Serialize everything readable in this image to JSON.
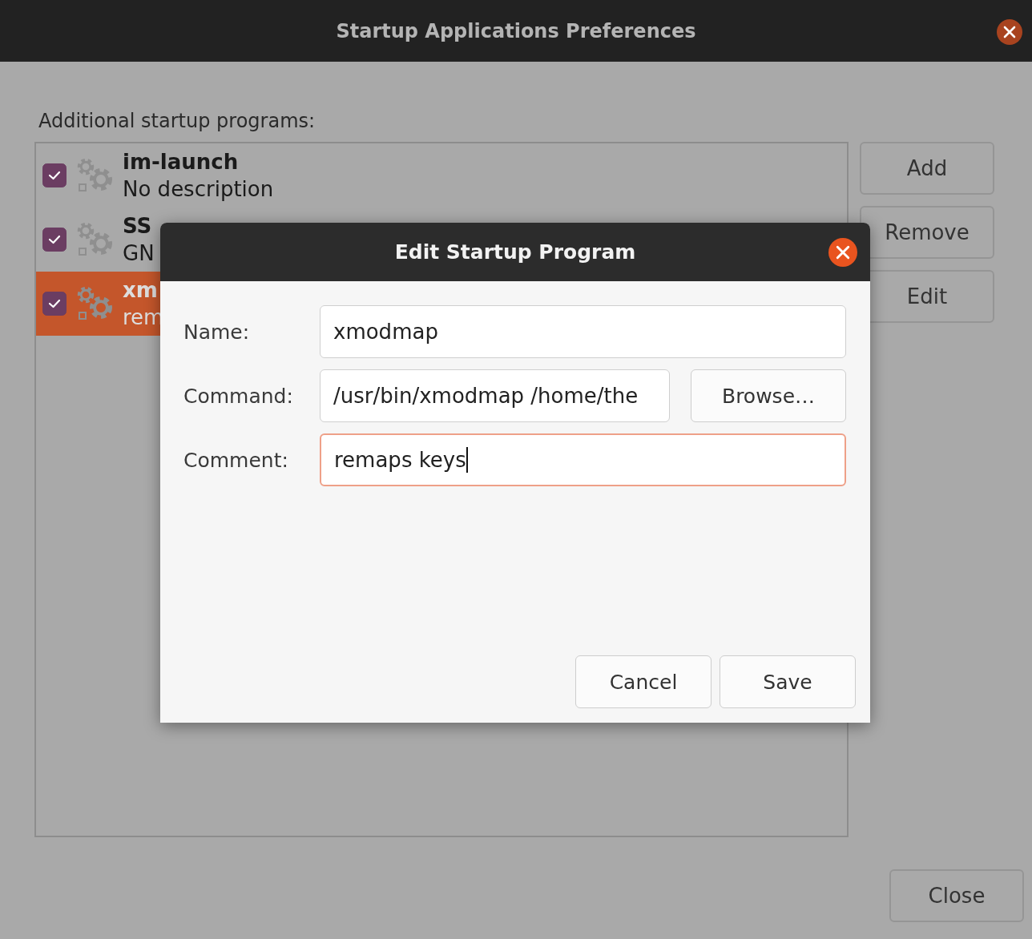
{
  "window": {
    "title": "Startup Applications Preferences"
  },
  "list_label": "Additional startup programs:",
  "programs": [
    {
      "name": "im-launch",
      "description": "No description",
      "enabled": true,
      "selected": false
    },
    {
      "name": "SS",
      "description": "GN",
      "enabled": true,
      "selected": false
    },
    {
      "name": "xm",
      "description": "rem",
      "enabled": true,
      "selected": true
    }
  ],
  "side_buttons": [
    "Add",
    "Remove",
    "Edit"
  ],
  "close_button": "Close",
  "dialog": {
    "title": "Edit Startup Program",
    "fields": [
      {
        "label": "Name:",
        "value": "xmodmap",
        "focused": false
      },
      {
        "label": "Command:",
        "value": "/usr/bin/xmodmap /home/the",
        "focused": false,
        "button": "Browse…"
      },
      {
        "label": "Comment:",
        "value": "remaps keys",
        "focused": true
      }
    ],
    "buttons": [
      "Cancel",
      "Save"
    ]
  }
}
